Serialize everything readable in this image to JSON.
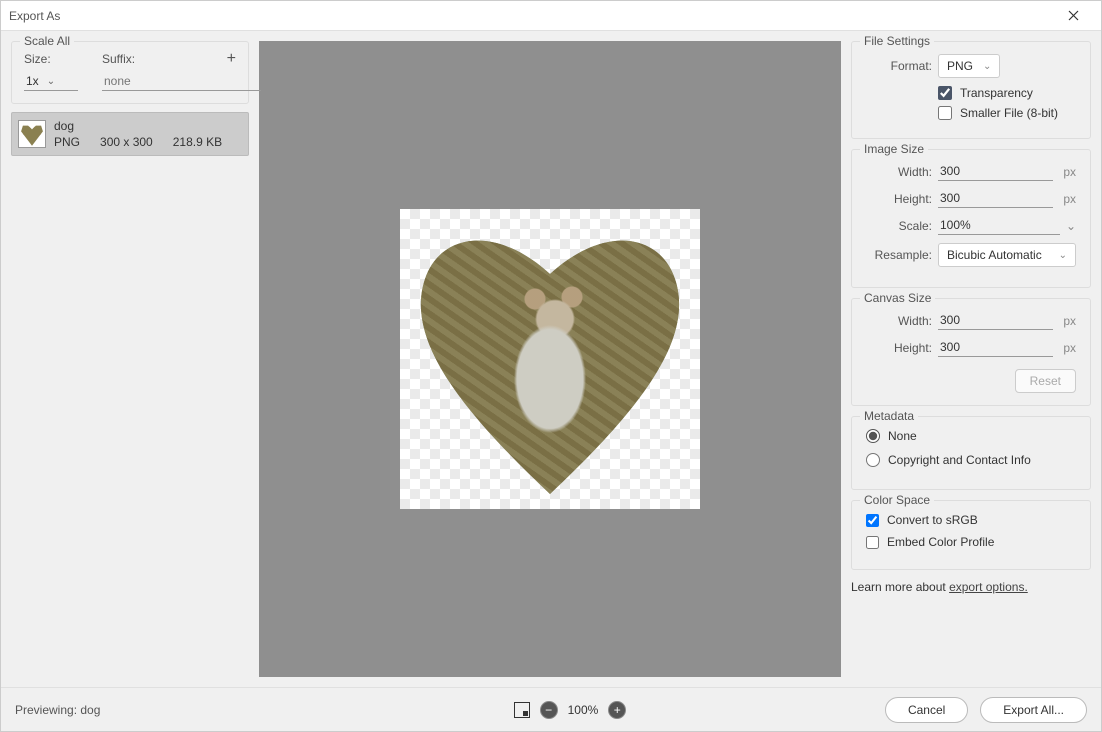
{
  "window": {
    "title": "Export As"
  },
  "scaleAll": {
    "legend": "Scale All",
    "sizeLabel": "Size:",
    "suffixLabel": "Suffix:",
    "size": "1x",
    "suffixPlaceholder": "none",
    "add": "+"
  },
  "asset": {
    "name": "dog",
    "format": "PNG",
    "dims": "300 x 300",
    "filesize": "218.9 KB"
  },
  "fileSettings": {
    "legend": "File Settings",
    "formatLabel": "Format:",
    "format": "PNG",
    "transparency": "Transparency",
    "smallerFile": "Smaller File (8-bit)",
    "transparencyChecked": true,
    "smallerChecked": false
  },
  "imageSize": {
    "legend": "Image Size",
    "widthLabel": "Width:",
    "heightLabel": "Height:",
    "scaleLabel": "Scale:",
    "resampleLabel": "Resample:",
    "width": "300",
    "height": "300",
    "scale": "100%",
    "resample": "Bicubic Automatic",
    "px": "px"
  },
  "canvasSize": {
    "legend": "Canvas Size",
    "widthLabel": "Width:",
    "heightLabel": "Height:",
    "width": "300",
    "height": "300",
    "px": "px",
    "reset": "Reset"
  },
  "metadata": {
    "legend": "Metadata",
    "none": "None",
    "copyright": "Copyright and Contact Info",
    "selected": "none"
  },
  "colorSpace": {
    "legend": "Color Space",
    "convert": "Convert to sRGB",
    "embed": "Embed Color Profile",
    "convertChecked": true,
    "embedChecked": false
  },
  "learn": {
    "prefix": "Learn more about ",
    "link": "export options."
  },
  "footer": {
    "previewing": "Previewing:  dog",
    "zoom": "100%",
    "cancel": "Cancel",
    "exportAll": "Export All..."
  }
}
